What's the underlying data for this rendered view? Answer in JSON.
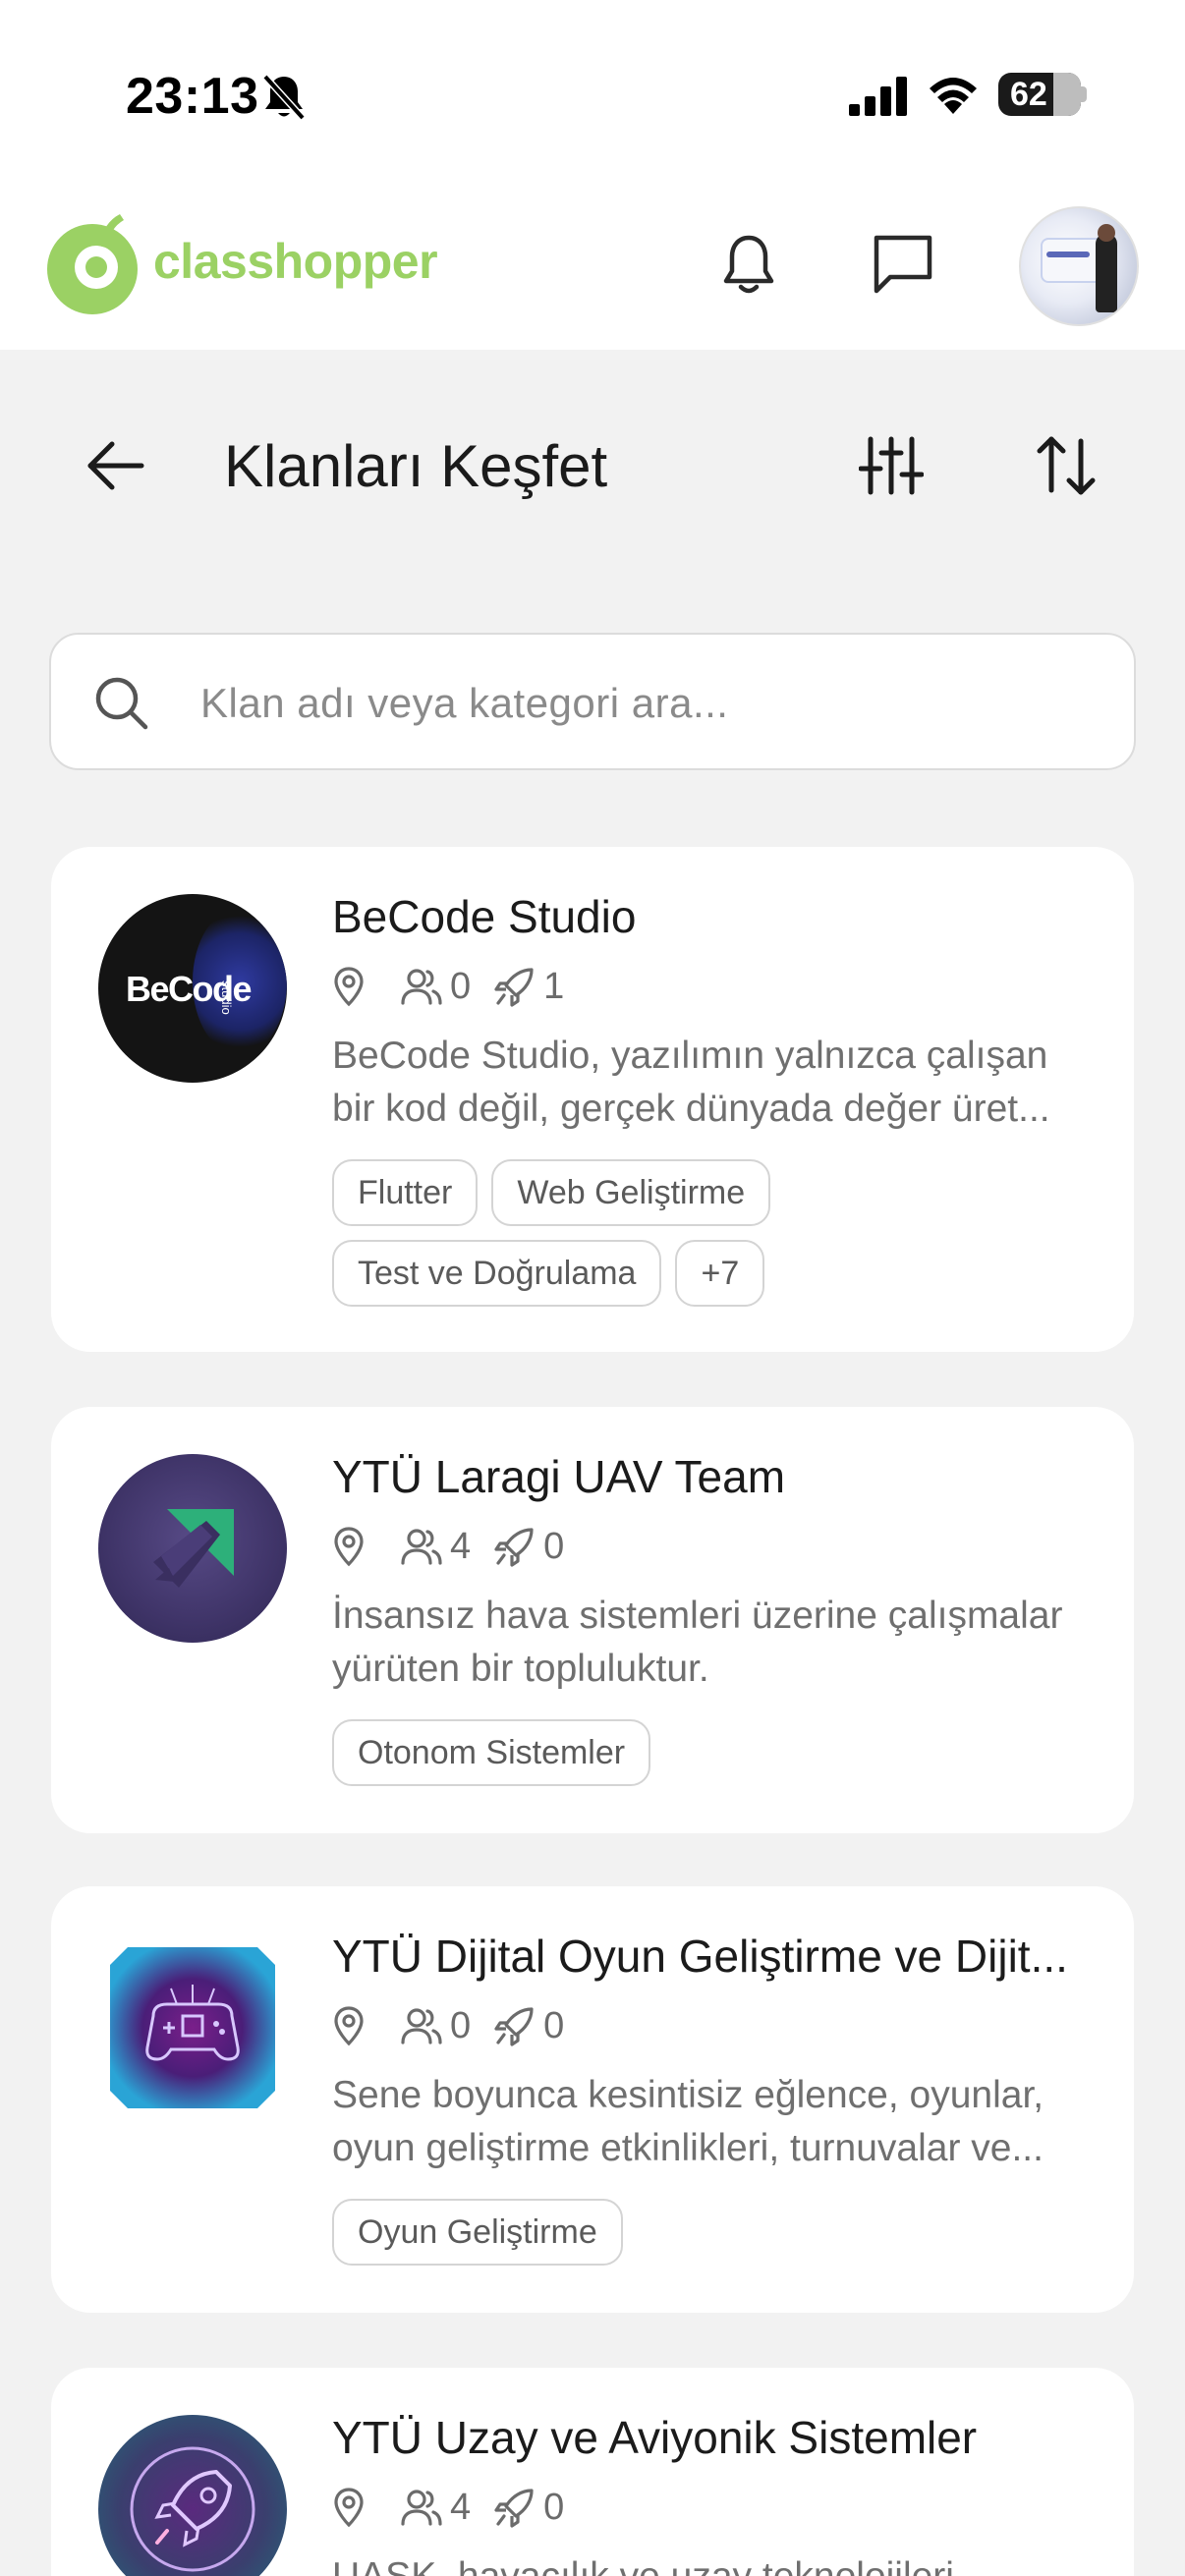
{
  "status_bar": {
    "time": "23:13",
    "battery": "62"
  },
  "app_bar": {
    "logo_text": "classhopper"
  },
  "page": {
    "title": "Klanları Keşfet"
  },
  "search": {
    "placeholder": "Klan adı veya kategori ara..."
  },
  "clans": [
    {
      "name": "BeCode Studio",
      "logo_text": "BeCode",
      "logo_subtext": "studio",
      "members": "0",
      "projects": "1",
      "description_lines": [
        "BeCode Studio, yazılımın yalnızca çalışan",
        "bir kod değil, gerçek dünyada değer üret..."
      ],
      "tags": [
        "Flutter",
        "Web Geliştirme",
        "Test ve Doğrulama",
        "+7"
      ]
    },
    {
      "name": "YTÜ Laragi UAV Team",
      "members": "4",
      "projects": "0",
      "description_lines": [
        "İnsansız hava sistemleri üzerine çalışmalar",
        "yürüten bir topluluktur."
      ],
      "tags": [
        "Otonom Sistemler"
      ]
    },
    {
      "name": "YTÜ Dijital Oyun Geliştirme ve Dijit...",
      "members": "0",
      "projects": "0",
      "description_lines": [
        "Sene boyunca kesintisiz eğlence, oyunlar,",
        "oyun geliştirme etkinlikleri, turnuvalar ve..."
      ],
      "tags": [
        "Oyun Geliştirme"
      ]
    },
    {
      "name": "YTÜ Uzay ve Aviyonik Sistemler",
      "members": "4",
      "projects": "0",
      "description_lines": [
        "UASK, havacılık ve uzay teknolojileri"
      ],
      "tags": []
    }
  ],
  "colors": {
    "brand_green": "#9bd164",
    "background": "#f2f2f2",
    "card": "#ffffff"
  },
  "icons": [
    "bell-off-icon",
    "signal-icon",
    "wifi-icon",
    "battery-icon",
    "classhopper-logo-icon",
    "bell-icon",
    "chat-icon",
    "back-arrow-icon",
    "filter-sliders-icon",
    "sort-icon",
    "search-icon",
    "location-pin-icon",
    "members-icon",
    "rocket-icon"
  ]
}
